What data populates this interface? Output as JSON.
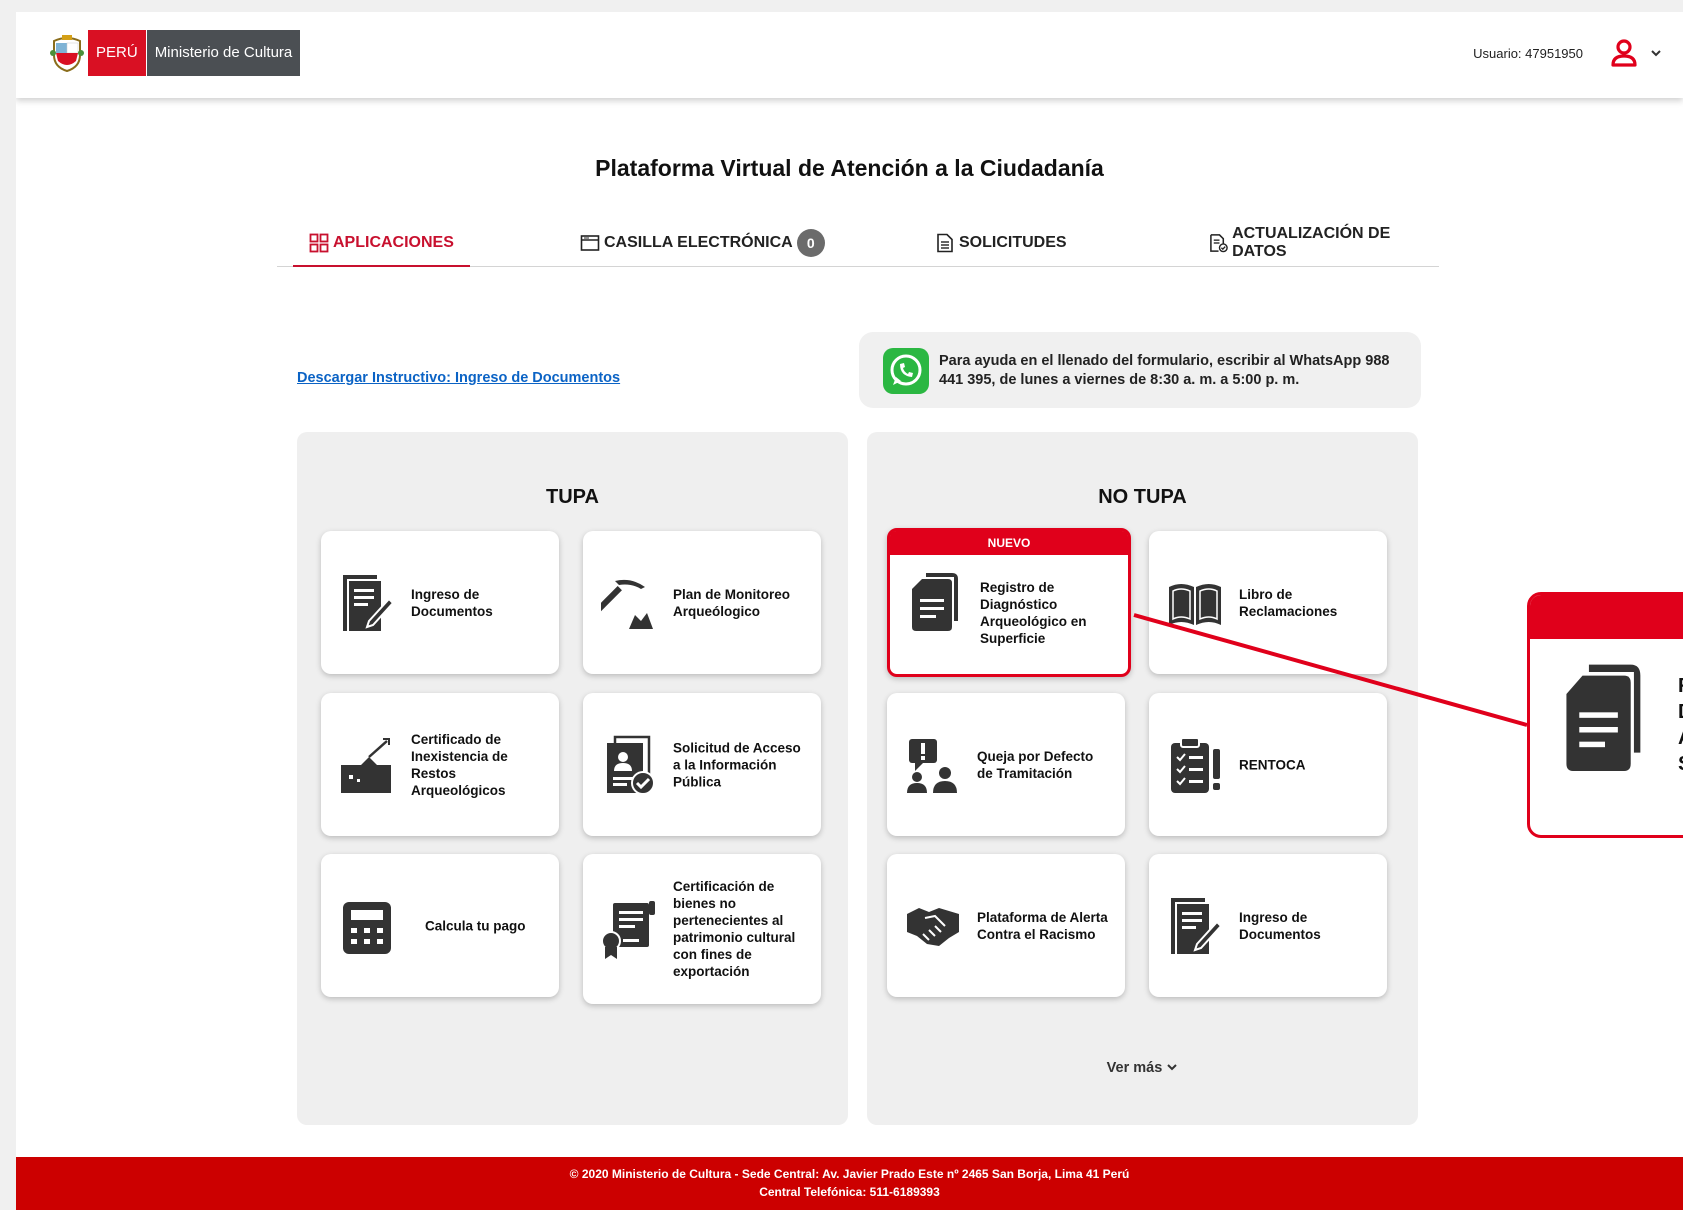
{
  "header": {
    "brand_country": "PERÚ",
    "brand_ministry": "Ministerio de Cultura",
    "user_label": "Usuario: 47951950",
    "user_icon": "user-icon",
    "accent_color": "#d91023"
  },
  "main": {
    "title": "Plataforma Virtual de Atención a la Ciudadanía",
    "tabs": [
      {
        "label": "APLICACIONES",
        "icon": "apps-grid-icon",
        "active": true
      },
      {
        "label": "CASILLA ELECTRÓNICA",
        "icon": "inbox-icon",
        "badge": "0"
      },
      {
        "label": "SOLICITUDES",
        "icon": "document-icon"
      },
      {
        "label": "ACTUALIZACIÓN DE DATOS",
        "icon": "document-check-icon"
      }
    ],
    "download_link": "Descargar Instructivo: Ingreso de Documentos",
    "whatsapp_help": "Para ayuda en el llenado del formulario, escribir al WhatsApp 988 441 395, de lunes a viernes de 8:30 a. m. a 5:00 p. m."
  },
  "tupa": {
    "title": "TUPA",
    "cards": [
      {
        "label": "Ingreso de Documentos",
        "icon": "document-edit-icon"
      },
      {
        "label": "Plan de Monitoreo Arqueólogico",
        "icon": "pickaxe-icon"
      },
      {
        "label": "Certificado de Inexistencia de Restos Arqueológicos",
        "icon": "excavation-icon"
      },
      {
        "label": "Solicitud de Acceso a la Información Pública",
        "icon": "id-document-check-icon"
      },
      {
        "label": "Calcula tu pago",
        "icon": "calculator-icon"
      },
      {
        "label": "Certificación de bienes no pertenecientes al patrimonio cultural con fines de exportación",
        "icon": "certificate-icon"
      }
    ]
  },
  "no_tupa": {
    "title": "NO TUPA",
    "new_badge": "NUEVO",
    "cards": [
      {
        "label": "Registro de Diagnóstico Arqueológico en Superficie",
        "icon": "documents-icon"
      },
      {
        "label": "Libro de Reclamaciones",
        "icon": "open-book-icon"
      },
      {
        "label": "Queja por Defecto de Tramitación",
        "icon": "complaint-people-icon"
      },
      {
        "label": "RENTOCA",
        "icon": "clipboard-checklist-icon"
      },
      {
        "label": "Plataforma de Alerta Contra el Racismo",
        "icon": "handshake-icon"
      },
      {
        "label": "Ingreso de Documentos",
        "icon": "document-edit-icon"
      }
    ],
    "ver_mas": "Ver más"
  },
  "callout": {
    "icon": "documents-icon",
    "letters": [
      "R",
      "D",
      "A",
      "S"
    ]
  },
  "footer": {
    "line1": "© 2020 Ministerio de Cultura - Sede Central: Av. Javier Prado Este nº 2465 San Borja, Lima 41 Perú",
    "line2": "Central Telefónica: 511-6189393"
  }
}
